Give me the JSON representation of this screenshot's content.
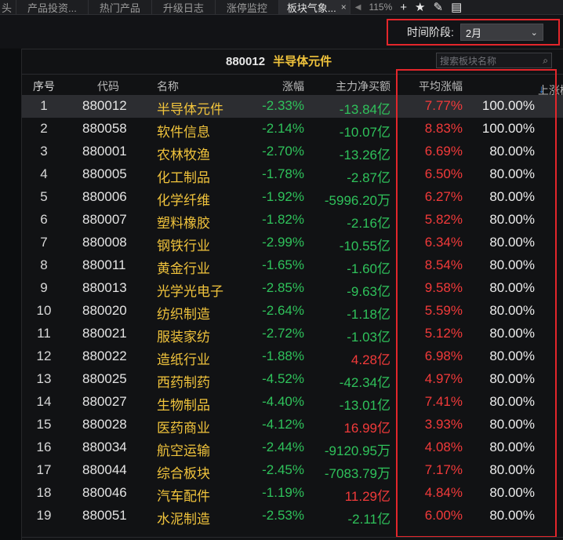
{
  "tabs": [
    {
      "label": "头",
      "active": false
    },
    {
      "label": "产品投资...",
      "active": false
    },
    {
      "label": "热门产品",
      "active": false
    },
    {
      "label": "升级日志",
      "active": false
    },
    {
      "label": "涨停监控",
      "active": false
    },
    {
      "label": "板块气象...",
      "active": true
    }
  ],
  "toolbar": {
    "tab_close_icon": "×",
    "arrow_icon": "◀",
    "zoom": "115%",
    "plus_icon": "+",
    "star_icon": "★",
    "pen_icon": "✎",
    "panel_icon": "▤"
  },
  "filter": {
    "label": "时间阶段:",
    "selected": "2月",
    "chevron_icon": "⌄"
  },
  "board": {
    "code": "880012",
    "name": "半导体元件"
  },
  "search": {
    "placeholder": "搜索板块名称",
    "icon": "⌕"
  },
  "columns": {
    "index": "序号",
    "code": "代码",
    "name": "名称",
    "change": "涨幅",
    "net_flow": "主力净买额",
    "avg_change": "平均涨幅",
    "up_prob": "上涨概率",
    "sort_icon": "↓"
  },
  "colors": {
    "up": "#f23a3a",
    "down": "#2fc25b",
    "name": "#f0c33c",
    "highlight_border": "#e3262b"
  },
  "rows": [
    {
      "index": "1",
      "code": "880012",
      "name": "半导体元件",
      "change": "-2.33%",
      "net_flow": "-13.84亿",
      "flow_dir": "neg",
      "avg_change": "7.77%",
      "up_prob": "100.00%"
    },
    {
      "index": "2",
      "code": "880058",
      "name": "软件信息",
      "change": "-2.14%",
      "net_flow": "-10.07亿",
      "flow_dir": "neg",
      "avg_change": "8.83%",
      "up_prob": "100.00%"
    },
    {
      "index": "3",
      "code": "880001",
      "name": "农林牧渔",
      "change": "-2.70%",
      "net_flow": "-13.26亿",
      "flow_dir": "neg",
      "avg_change": "6.69%",
      "up_prob": "80.00%"
    },
    {
      "index": "4",
      "code": "880005",
      "name": "化工制品",
      "change": "-1.78%",
      "net_flow": "-2.87亿",
      "flow_dir": "neg",
      "avg_change": "6.50%",
      "up_prob": "80.00%"
    },
    {
      "index": "5",
      "code": "880006",
      "name": "化学纤维",
      "change": "-1.92%",
      "net_flow": "-5996.20万",
      "flow_dir": "neg",
      "avg_change": "6.27%",
      "up_prob": "80.00%"
    },
    {
      "index": "6",
      "code": "880007",
      "name": "塑料橡胶",
      "change": "-1.82%",
      "net_flow": "-2.16亿",
      "flow_dir": "neg",
      "avg_change": "5.82%",
      "up_prob": "80.00%"
    },
    {
      "index": "7",
      "code": "880008",
      "name": "钢铁行业",
      "change": "-2.99%",
      "net_flow": "-10.55亿",
      "flow_dir": "neg",
      "avg_change": "6.34%",
      "up_prob": "80.00%"
    },
    {
      "index": "8",
      "code": "880011",
      "name": "黄金行业",
      "change": "-1.65%",
      "net_flow": "-1.60亿",
      "flow_dir": "neg",
      "avg_change": "8.54%",
      "up_prob": "80.00%"
    },
    {
      "index": "9",
      "code": "880013",
      "name": "光学光电子",
      "change": "-2.85%",
      "net_flow": "-9.63亿",
      "flow_dir": "neg",
      "avg_change": "9.58%",
      "up_prob": "80.00%"
    },
    {
      "index": "10",
      "code": "880020",
      "name": "纺织制造",
      "change": "-2.64%",
      "net_flow": "-1.18亿",
      "flow_dir": "neg",
      "avg_change": "5.59%",
      "up_prob": "80.00%"
    },
    {
      "index": "11",
      "code": "880021",
      "name": "服装家纺",
      "change": "-2.72%",
      "net_flow": "-1.03亿",
      "flow_dir": "neg",
      "avg_change": "5.12%",
      "up_prob": "80.00%"
    },
    {
      "index": "12",
      "code": "880022",
      "name": "造纸行业",
      "change": "-1.88%",
      "net_flow": "4.28亿",
      "flow_dir": "pos",
      "avg_change": "6.98%",
      "up_prob": "80.00%"
    },
    {
      "index": "13",
      "code": "880025",
      "name": "西药制药",
      "change": "-4.52%",
      "net_flow": "-42.34亿",
      "flow_dir": "neg",
      "avg_change": "4.97%",
      "up_prob": "80.00%"
    },
    {
      "index": "14",
      "code": "880027",
      "name": "生物制品",
      "change": "-4.40%",
      "net_flow": "-13.01亿",
      "flow_dir": "neg",
      "avg_change": "7.41%",
      "up_prob": "80.00%"
    },
    {
      "index": "15",
      "code": "880028",
      "name": "医药商业",
      "change": "-4.12%",
      "net_flow": "16.99亿",
      "flow_dir": "pos",
      "avg_change": "3.93%",
      "up_prob": "80.00%"
    },
    {
      "index": "16",
      "code": "880034",
      "name": "航空运输",
      "change": "-2.44%",
      "net_flow": "-9120.95万",
      "flow_dir": "neg",
      "avg_change": "4.08%",
      "up_prob": "80.00%"
    },
    {
      "index": "17",
      "code": "880044",
      "name": "综合板块",
      "change": "-2.45%",
      "net_flow": "-7083.79万",
      "flow_dir": "neg",
      "avg_change": "7.17%",
      "up_prob": "80.00%"
    },
    {
      "index": "18",
      "code": "880046",
      "name": "汽车配件",
      "change": "-1.19%",
      "net_flow": "11.29亿",
      "flow_dir": "pos",
      "avg_change": "4.84%",
      "up_prob": "80.00%"
    },
    {
      "index": "19",
      "code": "880051",
      "name": "水泥制造",
      "change": "-2.53%",
      "net_flow": "-2.11亿",
      "flow_dir": "neg",
      "avg_change": "6.00%",
      "up_prob": "80.00%"
    }
  ]
}
